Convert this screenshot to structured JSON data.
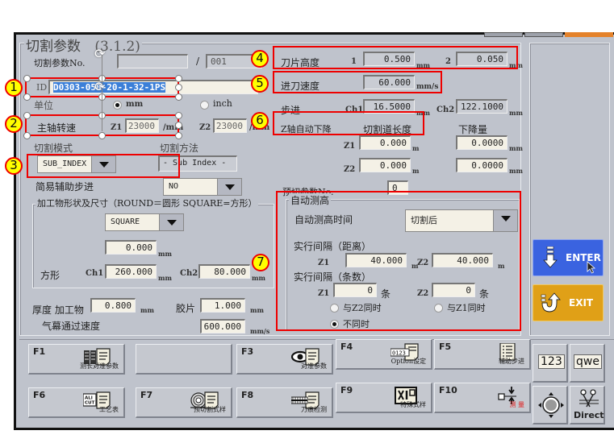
{
  "panel": {
    "title": "切割参数",
    "version": "(3.1.2)",
    "cut_param_no": {
      "label": "切割参数No.",
      "value": "",
      "separator": "/",
      "total": "001"
    },
    "id": {
      "label": "ID",
      "value": "D0303-050-20-1-32-1PS"
    },
    "unit": {
      "label": "单位",
      "options": [
        {
          "label": "mm",
          "selected": true
        },
        {
          "label": "inch",
          "selected": false
        }
      ]
    },
    "spindle": {
      "label": "主轴转速",
      "z1_label": "Z1",
      "z1_value": "23000",
      "z1_unit": "/min",
      "z2_label": "Z2",
      "z2_value": "23000",
      "z2_unit": "/min"
    },
    "cut_mode": {
      "label": "切割模式",
      "value": "SUB_INDEX"
    },
    "cut_method": {
      "label": "切割方法",
      "value": "- Sub Index -"
    },
    "simple_aux": {
      "label": "简易辅助步进",
      "value": "NO"
    },
    "workpiece_shape": {
      "title": "加工物形状及尺寸（ROUND＝圆形 SQUARE=方形）",
      "shape": "SQUARE",
      "diameter_value": "0.000",
      "diameter_unit": "mm",
      "square_label": "方形",
      "ch1_label": "Ch1",
      "ch1_value": "260.000",
      "ch1_unit": "mm",
      "ch2_label": "Ch2",
      "ch2_value": "80.000",
      "ch2_unit": "mm"
    },
    "thickness": {
      "label": "厚度 加工物",
      "work_value": "0.800",
      "work_unit": "mm",
      "tape_label": "胶片",
      "tape_value": "1.000",
      "tape_unit": "mm"
    },
    "air_curtain": {
      "label": "气幕通过速度",
      "value": "600.000",
      "unit": "mm/s"
    },
    "blade_height": {
      "label": "刀片高度",
      "l1": "1",
      "v1": "0.500",
      "u1": "mm",
      "l2": "2",
      "v2": "0.050",
      "u2": "mm"
    },
    "feed_speed": {
      "label": "进刀速度",
      "value": "60.000",
      "unit": "mm/s"
    },
    "index": {
      "label": "步进",
      "ch1_label": "Ch1",
      "ch1_value": "16.5000",
      "ch1_unit": "mm",
      "ch2_label": "Ch2",
      "ch2_value": "122.1000",
      "ch2_unit": "mm"
    },
    "z_auto_down": {
      "label": "Z轴自动下降",
      "length_label": "切割道长度",
      "amount_label": "下降量",
      "z1_label": "Z1",
      "z1_length": "0.000",
      "z1_length_unit": "m",
      "z1_amount": "0.0000",
      "z1_amount_unit": "mm",
      "z2_label": "Z2",
      "z2_length": "0.000",
      "z2_length_unit": "m",
      "z2_amount": "0.0000",
      "z2_amount_unit": "mm"
    },
    "precut_no": {
      "label": "预切参数No.",
      "value": "0"
    },
    "auto_height": {
      "title": "自动测高",
      "time_label": "自动测高时间",
      "time_value": "切割后",
      "dist_label": "实行间隔（距离）",
      "dist_z1_label": "Z1",
      "dist_z1": "40.000",
      "dist_z1_unit": "m",
      "dist_z2_label": "Z2",
      "dist_z2": "40.000",
      "dist_z2_unit": "m",
      "count_label": "实行间隔（条数）",
      "count_z1_label": "Z1",
      "count_z1": "0",
      "count_z1_unit": "条",
      "count_z2_label": "Z2",
      "count_z2": "0",
      "count_z2_unit": "条",
      "sync_options": [
        {
          "label": "与Z2同时",
          "selected": false
        },
        {
          "label": "与Z1同时",
          "selected": false
        },
        {
          "label": "不同时",
          "selected": true
        }
      ]
    }
  },
  "side_buttons": {
    "enter": "ENTER",
    "exit": "EXIT"
  },
  "function_keys": [
    {
      "key": "F1",
      "caption": "测长对准参数",
      "icon": "table-doc-icon"
    },
    {
      "key": "",
      "caption": "",
      "icon": ""
    },
    {
      "key": "F3",
      "caption": "对准参数",
      "icon": "eye-doc-icon"
    },
    {
      "key": "F4",
      "caption": "Option设定",
      "icon": "numbers-doc-icon",
      "icon_text": "0123"
    },
    {
      "key": "F5",
      "caption": "辅助步进",
      "icon": "list-doc-icon"
    },
    {
      "key": "F6",
      "caption": "工艺表",
      "icon": "ali-cut-doc-icon",
      "icon_text": "ALI CUT"
    },
    {
      "key": "F7",
      "caption": "预切割式样",
      "icon": "blade-doc-icon"
    },
    {
      "key": "F8",
      "caption": "刀痕检测",
      "icon": "kerf-doc-icon"
    },
    {
      "key": "F9",
      "caption": "特殊式样",
      "icon": "tools-icon"
    },
    {
      "key": "F10",
      "caption": "测 量",
      "icon": "measure-icon",
      "caption_color": "#e02020"
    }
  ],
  "keypad": {
    "numeric": "123",
    "alpha": "qwe",
    "direct": "Direct"
  },
  "annotations": [
    "1",
    "2",
    "3",
    "4",
    "5",
    "6",
    "7"
  ],
  "colors": {
    "enter": "#3a63e0",
    "exit": "#e0a017",
    "annotation_border": "#ee0000",
    "annotation_fill": "#ffff00",
    "selection": "#3b7fd8"
  }
}
